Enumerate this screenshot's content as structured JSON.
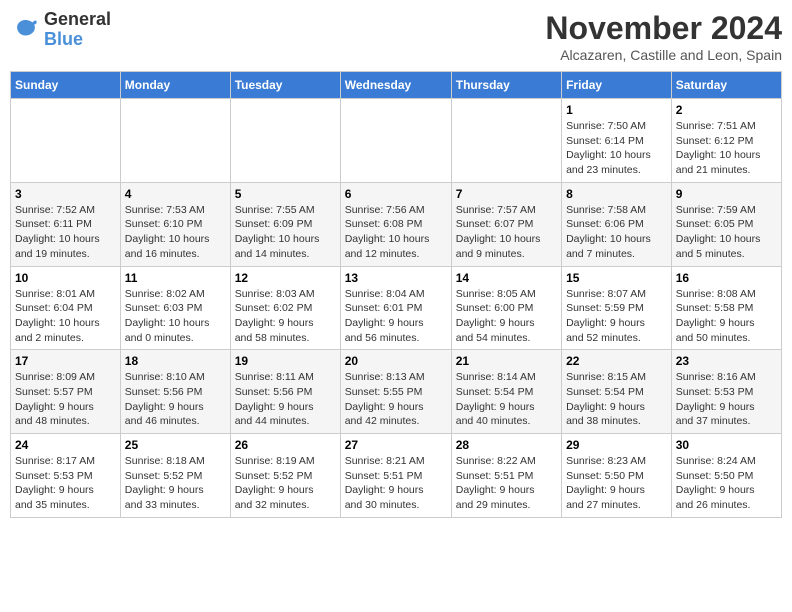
{
  "logo": {
    "line1": "General",
    "line2": "Blue"
  },
  "title": "November 2024",
  "location": "Alcazaren, Castille and Leon, Spain",
  "days_of_week": [
    "Sunday",
    "Monday",
    "Tuesday",
    "Wednesday",
    "Thursday",
    "Friday",
    "Saturday"
  ],
  "weeks": [
    [
      {
        "day": "",
        "info": ""
      },
      {
        "day": "",
        "info": ""
      },
      {
        "day": "",
        "info": ""
      },
      {
        "day": "",
        "info": ""
      },
      {
        "day": "",
        "info": ""
      },
      {
        "day": "1",
        "info": "Sunrise: 7:50 AM\nSunset: 6:14 PM\nDaylight: 10 hours\nand 23 minutes."
      },
      {
        "day": "2",
        "info": "Sunrise: 7:51 AM\nSunset: 6:12 PM\nDaylight: 10 hours\nand 21 minutes."
      }
    ],
    [
      {
        "day": "3",
        "info": "Sunrise: 7:52 AM\nSunset: 6:11 PM\nDaylight: 10 hours\nand 19 minutes."
      },
      {
        "day": "4",
        "info": "Sunrise: 7:53 AM\nSunset: 6:10 PM\nDaylight: 10 hours\nand 16 minutes."
      },
      {
        "day": "5",
        "info": "Sunrise: 7:55 AM\nSunset: 6:09 PM\nDaylight: 10 hours\nand 14 minutes."
      },
      {
        "day": "6",
        "info": "Sunrise: 7:56 AM\nSunset: 6:08 PM\nDaylight: 10 hours\nand 12 minutes."
      },
      {
        "day": "7",
        "info": "Sunrise: 7:57 AM\nSunset: 6:07 PM\nDaylight: 10 hours\nand 9 minutes."
      },
      {
        "day": "8",
        "info": "Sunrise: 7:58 AM\nSunset: 6:06 PM\nDaylight: 10 hours\nand 7 minutes."
      },
      {
        "day": "9",
        "info": "Sunrise: 7:59 AM\nSunset: 6:05 PM\nDaylight: 10 hours\nand 5 minutes."
      }
    ],
    [
      {
        "day": "10",
        "info": "Sunrise: 8:01 AM\nSunset: 6:04 PM\nDaylight: 10 hours\nand 2 minutes."
      },
      {
        "day": "11",
        "info": "Sunrise: 8:02 AM\nSunset: 6:03 PM\nDaylight: 10 hours\nand 0 minutes."
      },
      {
        "day": "12",
        "info": "Sunrise: 8:03 AM\nSunset: 6:02 PM\nDaylight: 9 hours\nand 58 minutes."
      },
      {
        "day": "13",
        "info": "Sunrise: 8:04 AM\nSunset: 6:01 PM\nDaylight: 9 hours\nand 56 minutes."
      },
      {
        "day": "14",
        "info": "Sunrise: 8:05 AM\nSunset: 6:00 PM\nDaylight: 9 hours\nand 54 minutes."
      },
      {
        "day": "15",
        "info": "Sunrise: 8:07 AM\nSunset: 5:59 PM\nDaylight: 9 hours\nand 52 minutes."
      },
      {
        "day": "16",
        "info": "Sunrise: 8:08 AM\nSunset: 5:58 PM\nDaylight: 9 hours\nand 50 minutes."
      }
    ],
    [
      {
        "day": "17",
        "info": "Sunrise: 8:09 AM\nSunset: 5:57 PM\nDaylight: 9 hours\nand 48 minutes."
      },
      {
        "day": "18",
        "info": "Sunrise: 8:10 AM\nSunset: 5:56 PM\nDaylight: 9 hours\nand 46 minutes."
      },
      {
        "day": "19",
        "info": "Sunrise: 8:11 AM\nSunset: 5:56 PM\nDaylight: 9 hours\nand 44 minutes."
      },
      {
        "day": "20",
        "info": "Sunrise: 8:13 AM\nSunset: 5:55 PM\nDaylight: 9 hours\nand 42 minutes."
      },
      {
        "day": "21",
        "info": "Sunrise: 8:14 AM\nSunset: 5:54 PM\nDaylight: 9 hours\nand 40 minutes."
      },
      {
        "day": "22",
        "info": "Sunrise: 8:15 AM\nSunset: 5:54 PM\nDaylight: 9 hours\nand 38 minutes."
      },
      {
        "day": "23",
        "info": "Sunrise: 8:16 AM\nSunset: 5:53 PM\nDaylight: 9 hours\nand 37 minutes."
      }
    ],
    [
      {
        "day": "24",
        "info": "Sunrise: 8:17 AM\nSunset: 5:53 PM\nDaylight: 9 hours\nand 35 minutes."
      },
      {
        "day": "25",
        "info": "Sunrise: 8:18 AM\nSunset: 5:52 PM\nDaylight: 9 hours\nand 33 minutes."
      },
      {
        "day": "26",
        "info": "Sunrise: 8:19 AM\nSunset: 5:52 PM\nDaylight: 9 hours\nand 32 minutes."
      },
      {
        "day": "27",
        "info": "Sunrise: 8:21 AM\nSunset: 5:51 PM\nDaylight: 9 hours\nand 30 minutes."
      },
      {
        "day": "28",
        "info": "Sunrise: 8:22 AM\nSunset: 5:51 PM\nDaylight: 9 hours\nand 29 minutes."
      },
      {
        "day": "29",
        "info": "Sunrise: 8:23 AM\nSunset: 5:50 PM\nDaylight: 9 hours\nand 27 minutes."
      },
      {
        "day": "30",
        "info": "Sunrise: 8:24 AM\nSunset: 5:50 PM\nDaylight: 9 hours\nand 26 minutes."
      }
    ]
  ]
}
